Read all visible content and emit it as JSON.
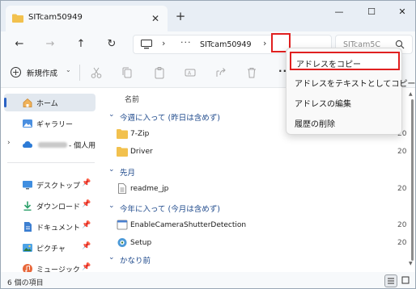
{
  "window": {
    "tab_title": "SITcam50949",
    "new_tab_symbol": "+",
    "close_tab_symbol": "✕",
    "controls": {
      "minimize": "—",
      "maximize": "☐",
      "close": "✕"
    }
  },
  "navigation": {
    "back": "←",
    "forward": "→",
    "up": "↑",
    "refresh": "↻",
    "address": {
      "ellipsis": "···",
      "crumb": "SITcam50949",
      "chevron": "›"
    },
    "search": {
      "placeholder": "SITcam5C"
    }
  },
  "toolbar": {
    "new_label": "新規作成",
    "new_caret": "⌄",
    "more": "···"
  },
  "sidebar": {
    "items": [
      {
        "label": "ホーム"
      },
      {
        "label": "ギャラリー"
      },
      {
        "label": "- 個人用"
      },
      {
        "label": "デスクトップ"
      },
      {
        "label": "ダウンロード"
      },
      {
        "label": "ドキュメント"
      },
      {
        "label": "ピクチャ"
      },
      {
        "label": "ミュージック"
      }
    ],
    "pin_symbol": "📌",
    "expand_symbol": "›"
  },
  "content": {
    "column_name": "名前",
    "groups": [
      {
        "label": "今週に入って (昨日は含めず)",
        "files": [
          {
            "name": "7-Zip",
            "date": "20"
          },
          {
            "name": "Driver",
            "date": "20"
          }
        ]
      },
      {
        "label": "先月",
        "files": [
          {
            "name": "readme_jp",
            "date": "20"
          }
        ]
      },
      {
        "label": "今年に入って (今月は含めず)",
        "files": [
          {
            "name": "EnableCameraShutterDetection",
            "date": "20"
          },
          {
            "name": "Setup",
            "date": "20"
          }
        ]
      },
      {
        "label": "かなり前",
        "files": []
      }
    ]
  },
  "status": {
    "item_count": "6 個の項目"
  },
  "context_menu": {
    "items": [
      {
        "label": "アドレスをコピー"
      },
      {
        "label": "アドレスをテキストとしてコピー"
      },
      {
        "label": "アドレスの編集"
      },
      {
        "label": "履歴の削除"
      }
    ]
  },
  "colors": {
    "accent": "#2a62c4",
    "highlight_box": "#e02020",
    "folder": "#f2c14e",
    "group_label": "#1f4a8c"
  }
}
